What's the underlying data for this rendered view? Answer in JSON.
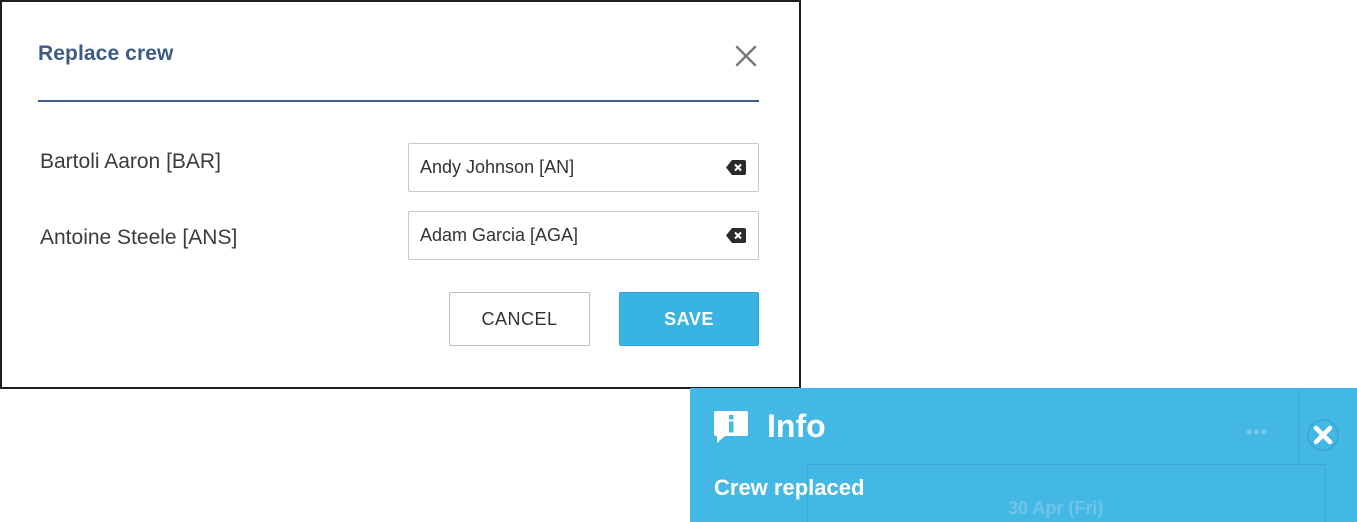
{
  "dialog": {
    "title": "Replace crew",
    "close_icon": "close-icon",
    "rows": [
      {
        "crew": "Bartoli Aaron [BAR]",
        "replacement": "Andy Johnson [AN]",
        "clear_icon": "backspace-clear-icon"
      },
      {
        "crew": "Antoine Steele [ANS]",
        "replacement": "Adam Garcia [AGA]",
        "clear_icon": "backspace-clear-icon"
      }
    ],
    "cancel_label": "CANCEL",
    "save_label": "SAVE",
    "colors": {
      "title": "#3d5b83",
      "save_button": "#39b3e2"
    }
  },
  "toast": {
    "icon": "info-speech-bubble-icon",
    "title": "Info",
    "message": "Crew replaced",
    "menu_icon": "more-dots-icon",
    "close_icon": "close-circle-icon",
    "background_text": "30 Apr (Fri)",
    "colors": {
      "background": "#44b8e4"
    }
  }
}
